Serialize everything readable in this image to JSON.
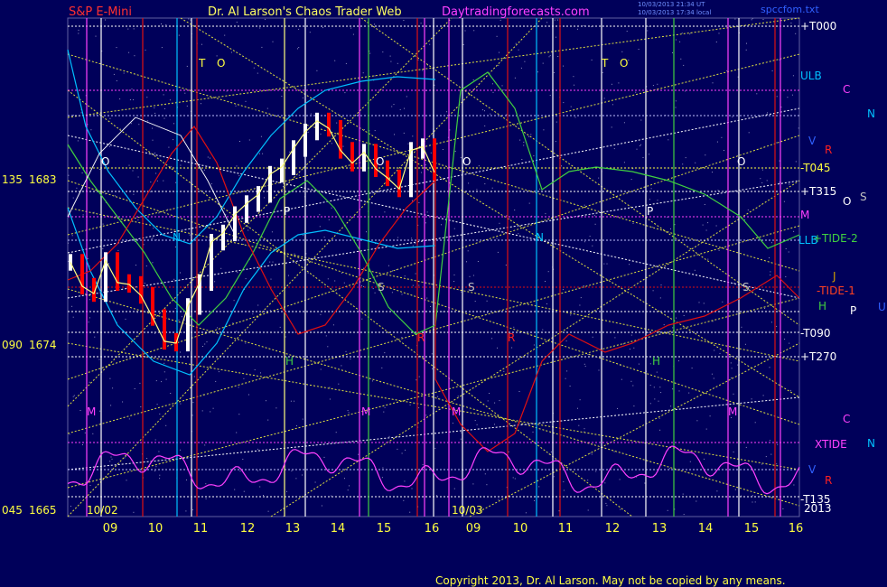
{
  "header": {
    "symbol": "S&P E-Mini",
    "author": "Dr. Al Larson's Chaos Trader Web",
    "site": "Daytradingforecasts.com",
    "stamp1": "10/03/2013 21:34 UT",
    "stamp2": "10/03/2013 17:34 local",
    "file": "spccfom.txt"
  },
  "footer": {
    "copyright": "Copyright 2013, Dr. Al Larson. May not be copied by any means."
  },
  "colors": {
    "background": "#00005a",
    "price_up": "#ffffff",
    "price_mid": "#ffff80",
    "price_down": "#ff0000",
    "grid_yellow": "#ffff40",
    "white_tides": "#ffffff",
    "magenta": "#ff40ff",
    "cyan": "#00c0ff",
    "green": "#40d040",
    "red": "#e01010",
    "blue_label": "#3060ff"
  },
  "chart_data": {
    "type": "line",
    "title": "S&P E-Mini",
    "x_ticks": [
      "09",
      "10",
      "11",
      "12",
      "13",
      "14",
      "15",
      "16",
      "09",
      "10",
      "11",
      "12",
      "13",
      "14",
      "15",
      "16"
    ],
    "date_labels": [
      "10/02",
      "10/03"
    ],
    "y_ticks": [
      {
        "angle": "135",
        "price": "1683"
      },
      {
        "angle": "090",
        "price": "1674"
      },
      {
        "angle": "045",
        "price": "1665"
      }
    ],
    "ylim": [
      1665,
      1683
    ],
    "right_labels": [
      {
        "text": "+T000",
        "color": "#ffffff"
      },
      {
        "text": "ULB",
        "color": "#00c0ff"
      },
      {
        "text": "-T045",
        "color": "#ffff40"
      },
      {
        "text": "+T315",
        "color": "#ffffff"
      },
      {
        "text": "M",
        "color": "#ff40ff"
      },
      {
        "text": "LLB",
        "color": "#00c0ff"
      },
      {
        "text": "+TIDE-2",
        "color": "#40d040"
      },
      {
        "text": "J",
        "color": "#d0a000"
      },
      {
        "text": "-TIDE-1",
        "color": "#ff4020"
      },
      {
        "text": "H",
        "color": "#40d040"
      },
      {
        "text": "-T090",
        "color": "#ffffff"
      },
      {
        "text": "+T270",
        "color": "#ffffff"
      },
      {
        "text": "XTIDE",
        "color": "#ff40ff"
      },
      {
        "text": "-T135",
        "color": "#ffffff"
      },
      {
        "text": "2013",
        "color": "#ffffff"
      },
      {
        "text": "C",
        "color": "#ff40ff"
      },
      {
        "text": "N",
        "color": "#00c0ff"
      },
      {
        "text": "R",
        "color": "#ff2020"
      },
      {
        "text": "O",
        "color": "#ffffff"
      },
      {
        "text": "S",
        "color": "#c0c0c0"
      },
      {
        "text": "P",
        "color": "#ffffff"
      },
      {
        "text": "U",
        "color": "#3060ff"
      },
      {
        "text": "V",
        "color": "#3060ff"
      },
      {
        "text": "C",
        "color": "#ff40ff"
      },
      {
        "text": "N",
        "color": "#00c0ff"
      },
      {
        "text": "V",
        "color": "#3060ff"
      },
      {
        "text": "R",
        "color": "#ff2020"
      }
    ],
    "planet_letters": [
      {
        "text": "T",
        "color": "#ffff40"
      },
      {
        "text": "O",
        "color": "#ffff40"
      },
      {
        "text": "O",
        "color": "#ffffff"
      },
      {
        "text": "N",
        "color": "#00c0ff"
      },
      {
        "text": "P",
        "color": "#ffffff"
      },
      {
        "text": "H",
        "color": "#40d040"
      },
      {
        "text": "S",
        "color": "#c0c0c0"
      },
      {
        "text": "O",
        "color": "#ffffff"
      },
      {
        "text": "R",
        "color": "#ff2020"
      },
      {
        "text": "M",
        "color": "#ff40ff"
      },
      {
        "text": "M",
        "color": "#ff40ff"
      },
      {
        "text": "T",
        "color": "#ffff40"
      },
      {
        "text": "O",
        "color": "#ffff40"
      },
      {
        "text": "O",
        "color": "#ffffff"
      },
      {
        "text": "N",
        "color": "#00c0ff"
      },
      {
        "text": "S",
        "color": "#c0c0c0"
      },
      {
        "text": "R",
        "color": "#ff2020"
      },
      {
        "text": "M",
        "color": "#ff40ff"
      },
      {
        "text": "P",
        "color": "#ffffff"
      },
      {
        "text": "H",
        "color": "#40d040"
      },
      {
        "text": "S",
        "color": "#c0c0c0"
      },
      {
        "text": "O",
        "color": "#ffffff"
      },
      {
        "text": "M",
        "color": "#ff40ff"
      }
    ],
    "series": [
      {
        "values": [
          1678.5,
          1677.2,
          1676.8,
          1678.6,
          1677.4,
          1677.3,
          1676.7,
          1675.5,
          1674.2,
          1674.1,
          1676.1,
          1677.4,
          1679.6,
          1680.1,
          1681.1,
          1681.7,
          1682.2,
          1683.3,
          1683.7,
          1684.7,
          1685.6,
          1686.2,
          1685.8,
          1684.6,
          1683.9,
          1684.5,
          1683.6,
          1683.1,
          1682.5,
          1684.6,
          1684.8,
          1683.4
        ]
      },
      {
        "name": "ULB"
      },
      {
        "name": "LLB"
      },
      {
        "name": "+TIDE-2"
      },
      {
        "name": "-TIDE-1"
      },
      {
        "name": "XTIDE"
      }
    ]
  }
}
